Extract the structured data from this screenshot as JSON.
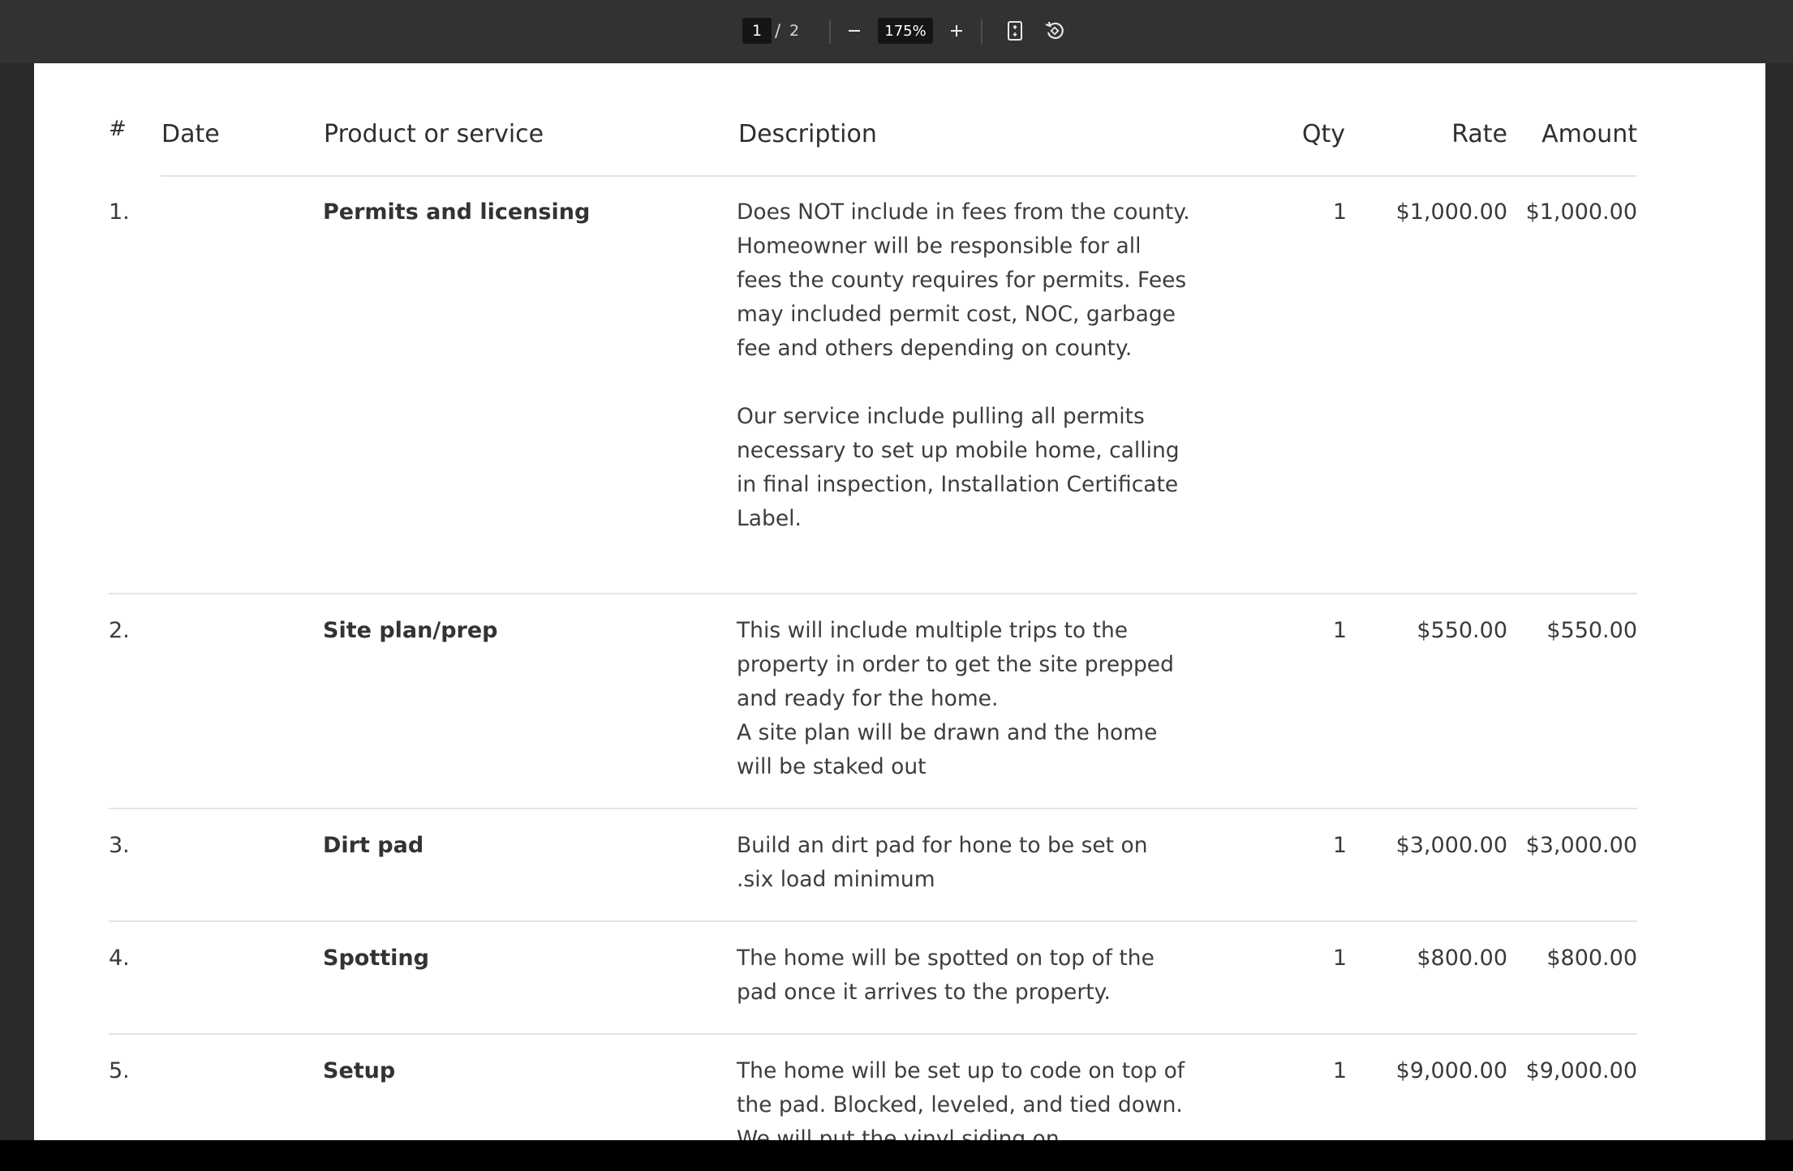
{
  "toolbar": {
    "current_page": "1",
    "page_separator": "/",
    "total_pages": "2",
    "zoom_out_icon": "minus-icon",
    "zoom_level": "175%",
    "zoom_in_icon": "plus-icon",
    "fit_page_icon": "fit-to-page-icon",
    "rotate_icon": "rotate-icon"
  },
  "table": {
    "headers": {
      "num": "#",
      "date": "Date",
      "product": "Product or service",
      "description": "Description",
      "qty": "Qty",
      "rate": "Rate",
      "amount": "Amount"
    },
    "rows": [
      {
        "num": "1.",
        "date": "",
        "product": "Permits and licensing",
        "description": [
          "Does NOT include in fees from the county. Homeowner will be responsible for all fees the county requires for permits. Fees may included permit cost, NOC, garbage fee and others depending on county.",
          "Our service include pulling all permits necessary to set up mobile home, calling in final inspection, Installation Certificate Label."
        ],
        "qty": "1",
        "rate": "$1,000.00",
        "amount": "$1,000.00"
      },
      {
        "num": "2.",
        "date": "",
        "product": "Site plan/prep",
        "description": [
          "This will include multiple trips to the property in order to get the site prepped and ready for the home.",
          "A site plan will be drawn and the home will be staked out"
        ],
        "qty": "1",
        "rate": "$550.00",
        "amount": "$550.00"
      },
      {
        "num": "3.",
        "date": "",
        "product": "Dirt pad",
        "description": [
          "Build an dirt pad for hone to be set on .six load minimum"
        ],
        "qty": "1",
        "rate": "$3,000.00",
        "amount": "$3,000.00"
      },
      {
        "num": "4.",
        "date": "",
        "product": "Spotting",
        "description": [
          "The home will be spotted on top of the pad once it arrives to the property."
        ],
        "qty": "1",
        "rate": "$800.00",
        "amount": "$800.00"
      },
      {
        "num": "5.",
        "date": "",
        "product": "Setup",
        "description": [
          "The home will be set up to code on top of the pad. Blocked, leveled, and tied down. We will put the vinyl siding on"
        ],
        "qty": "1",
        "rate": "$9,000.00",
        "amount": "$9,000.00"
      }
    ]
  }
}
